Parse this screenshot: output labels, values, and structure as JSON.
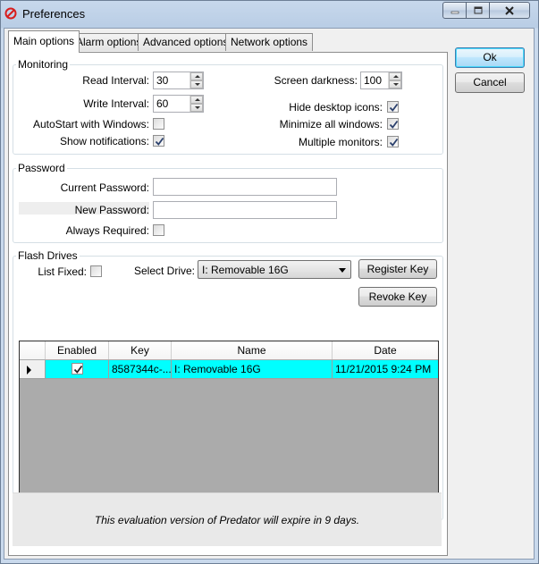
{
  "window": {
    "title": "Preferences"
  },
  "tabs": [
    {
      "label": "Main options",
      "active": true
    },
    {
      "label": "Alarm options",
      "active": false
    },
    {
      "label": "Advanced options",
      "active": false
    },
    {
      "label": "Network options",
      "active": false
    }
  ],
  "buttons": {
    "ok": "Ok",
    "cancel": "Cancel"
  },
  "monitoring": {
    "title": "Monitoring",
    "read_interval_label": "Read Interval:",
    "read_interval_value": "30",
    "write_interval_label": "Write Interval:",
    "write_interval_value": "60",
    "autostart_label": "AutoStart with Windows:",
    "autostart_checked": false,
    "notifications_label": "Show notifications:",
    "notifications_checked": true,
    "screen_darkness_label": "Screen darkness:",
    "screen_darkness_value": "100",
    "hide_icons_label": "Hide desktop icons:",
    "hide_icons_checked": true,
    "minimize_label": "Minimize all windows:",
    "minimize_checked": true,
    "multi_monitors_label": "Multiple monitors:",
    "multi_monitors_checked": true
  },
  "password": {
    "title": "Password",
    "current_label": "Current Password:",
    "current_value": "",
    "new_label": "New Password:",
    "new_value": "",
    "always_label": "Always Required:",
    "always_checked": false
  },
  "flash": {
    "title": "Flash Drives",
    "list_fixed_label": "List Fixed:",
    "list_fixed_checked": false,
    "select_drive_label": "Select Drive:",
    "selected_drive": "I: Removable 16G",
    "register_label": "Register Key",
    "revoke_label": "Revoke Key",
    "columns": [
      "Enabled",
      "Key",
      "Name",
      "Date"
    ],
    "rows": [
      {
        "enabled": true,
        "key": "8587344c-...",
        "name": "I: Removable 16G",
        "date": "11/21/2015 9:24 PM"
      }
    ]
  },
  "footer": {
    "message": "This evaluation version of Predator will expire in 9 days."
  },
  "colors": {
    "selected_row": "#00ffff",
    "grid_background": "#ababab"
  }
}
